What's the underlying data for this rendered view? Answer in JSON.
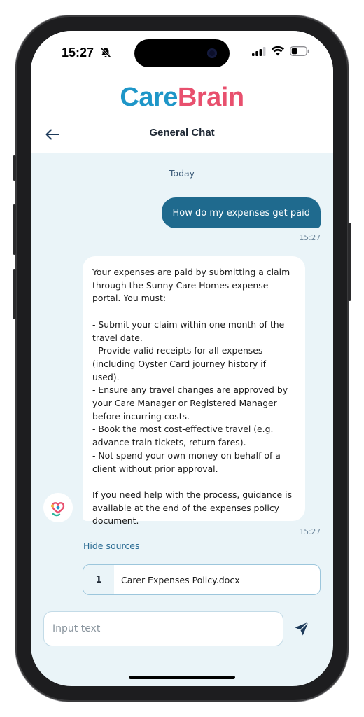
{
  "status_bar": {
    "time": "15:27"
  },
  "app": {
    "logo_part1": "Care",
    "logo_part2": "Brain",
    "brand_blue": "#1e96c8",
    "brand_pink": "#e8506e"
  },
  "header": {
    "title": "General Chat"
  },
  "chat": {
    "date_label": "Today",
    "user_message": {
      "text": "How do my expenses get paid",
      "time": "15:27"
    },
    "bot_message": {
      "text": "Your expenses are paid by submitting a claim through the Sunny Care Homes expense portal. You must:\n\n- Submit your claim within one month of the travel date.\n- Provide valid receipts for all expenses (including Oyster Card journey history if used).\n- Ensure any travel changes are approved by your Care Manager or Registered Manager before incurring costs.\n- Book the most cost-effective travel (e.g. advance train tickets, return fares).\n- Not spend your own money on behalf of a client without prior approval.\n\nIf you need help with the process, guidance is available at the end of the expenses policy document.",
      "time": "15:27"
    },
    "sources_toggle": "Hide sources",
    "sources": [
      {
        "index": "1",
        "name": "Carer Expenses Policy.docx"
      }
    ]
  },
  "composer": {
    "placeholder": "Input text",
    "value": ""
  },
  "colors": {
    "user_bubble": "#1f6a8e",
    "chat_background": "#eaf4f8"
  }
}
